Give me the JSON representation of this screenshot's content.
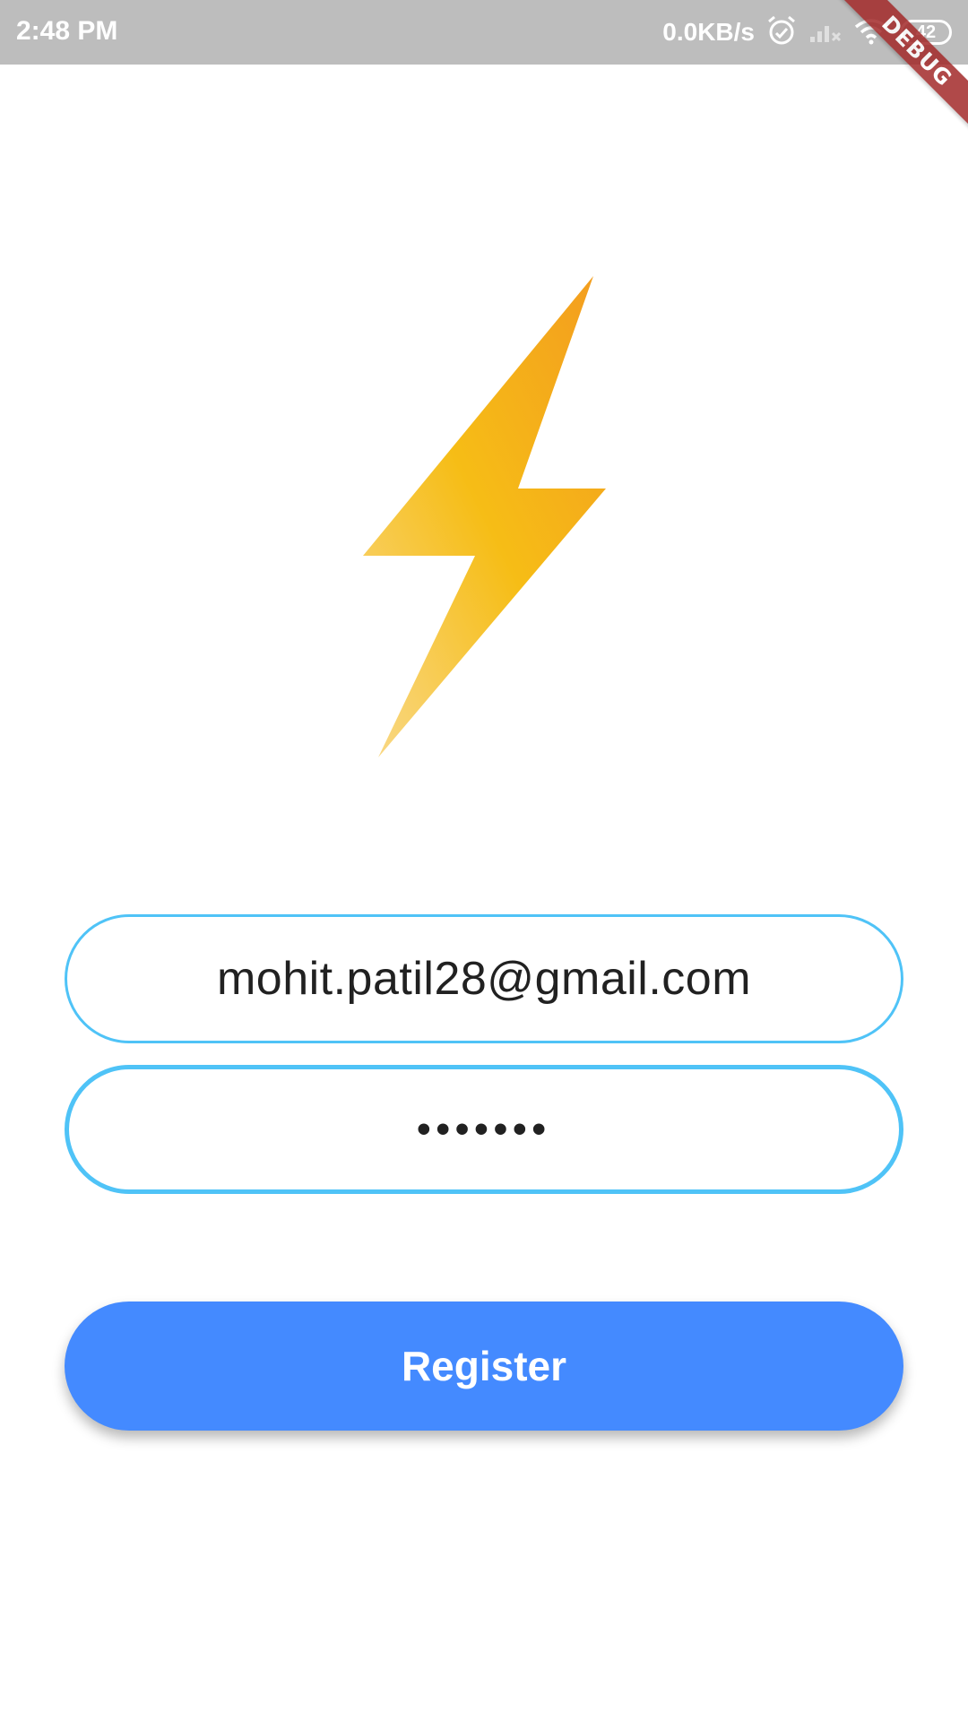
{
  "status_bar": {
    "time": "2:48 PM",
    "network_speed": "0.0KB/s",
    "battery_level": "42",
    "icons": [
      "alarm-icon",
      "signal-icon",
      "wifi-icon",
      "battery-icon"
    ]
  },
  "debug_banner": {
    "label": "DEBUG"
  },
  "logo": {
    "icon": "lightning-bolt-icon",
    "colors": [
      "#f39c1f",
      "#f6bd16",
      "#f9d98a"
    ]
  },
  "form": {
    "email_value": "mohit.patil28@gmail.com",
    "password_masked": "•••••••",
    "border_color": "#4fc3f7"
  },
  "register_button": {
    "label": "Register",
    "color": "#448aff"
  }
}
